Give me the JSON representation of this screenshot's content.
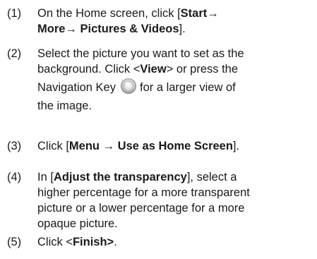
{
  "steps": [
    {
      "number": "(1)",
      "lines": [
        {
          "t1": "On the Home screen, click [",
          "b1": "Start→"
        },
        {
          "b1": "More→ Pictures & Videos",
          "t1": "]."
        }
      ]
    },
    {
      "number": "(2)",
      "lines": [
        {
          "t1": "Select the picture you want to set as the"
        },
        {
          "t1": "background. Click <",
          "b1": "View",
          "t2": "> or press the"
        },
        {
          "t1": "Navigation Key",
          "t2": "for a larger view of"
        },
        {
          "t1": "the image."
        }
      ]
    },
    {
      "number": "(3)",
      "lines": [
        {
          "t1": "Click [",
          "b1": "Menu → Use as Home Screen",
          "t2": "]."
        }
      ]
    },
    {
      "number": "(4)",
      "lines": [
        {
          "t1": "In [",
          "b1": "Adjust the transparency",
          "t2": "], select a"
        },
        {
          "t1": "higher percentage for a more transparent"
        },
        {
          "t1": "picture or a lower percentage for a more"
        },
        {
          "t1": "opaque picture."
        }
      ]
    },
    {
      "number": "(5)",
      "lines": [
        {
          "t1": "Click <",
          "b1": "Finish>",
          "t2": "."
        }
      ]
    }
  ],
  "icons": {
    "navigation_key": "navigation-key-icon"
  }
}
